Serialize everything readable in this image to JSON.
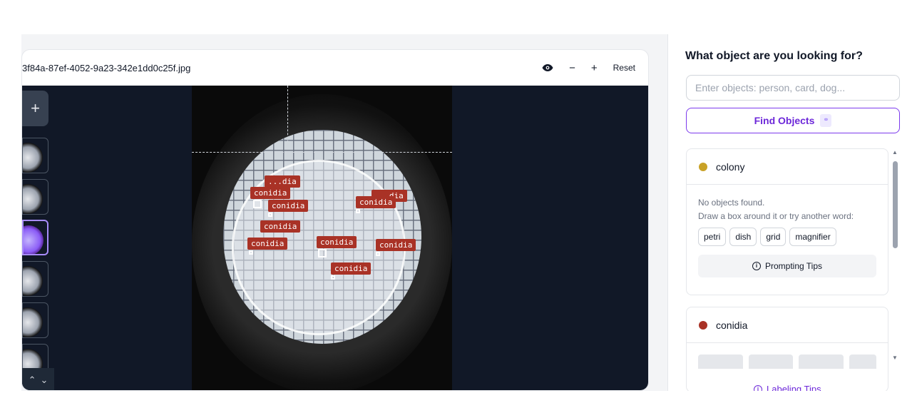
{
  "canvas": {
    "file_name": "3f84a-87ef-4052-9a23-342e1dd0c25f.jpg",
    "controls": {
      "zoom_out": "−",
      "zoom_in": "+",
      "reset": "Reset"
    },
    "add_label": "+",
    "detections": [
      {
        "label": "...dia"
      },
      {
        "label": "conidia"
      },
      {
        "label": "conidia"
      },
      {
        "label": "...dia"
      },
      {
        "label": "conidia"
      },
      {
        "label": "conidia"
      },
      {
        "label": "conidia"
      },
      {
        "label": "conidia"
      },
      {
        "label": "conidia"
      },
      {
        "label": "conidia"
      }
    ]
  },
  "sidebar": {
    "title": "What object are you looking for?",
    "search_placeholder": "Enter objects: person, card, dog...",
    "find_label": "Find Objects",
    "categories": [
      {
        "name": "colony",
        "color": "#c9a227",
        "empty_line1": "No objects found.",
        "empty_line2": "Draw a box around it or try another word:",
        "suggestions": [
          "petri",
          "dish",
          "grid",
          "magnifier"
        ],
        "tips_label": "Prompting Tips"
      },
      {
        "name": "conidia",
        "color": "#a93226"
      }
    ],
    "labeling_tips": "Labeling Tips"
  },
  "icons": {
    "eye": "eye-icon",
    "info": "info-icon",
    "kbd": "link-icon"
  }
}
